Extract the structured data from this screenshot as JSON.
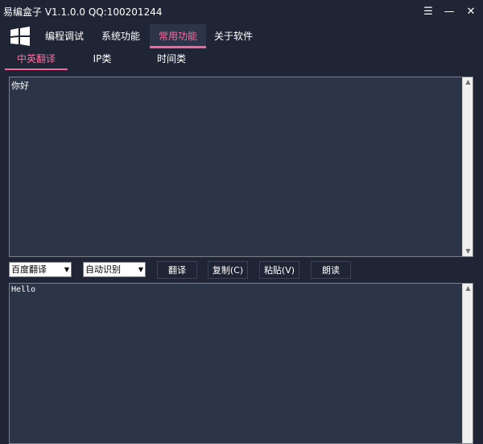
{
  "window": {
    "title": "易编盒子 V1.1.0.0 QQ:100201244",
    "buttons": {
      "settings": "☰",
      "minimize": "—",
      "close": "✕"
    }
  },
  "menu": {
    "items": [
      "编程调试",
      "系统功能",
      "常用功能",
      "关于软件"
    ],
    "active_index": 2
  },
  "subtabs": {
    "items": [
      "中英翻译",
      "IP类",
      "时间类"
    ],
    "active_index": 0
  },
  "input_area": {
    "text": "你好"
  },
  "controls": {
    "engine_select": "百度翻译",
    "language_select": "自动识别",
    "buttons": [
      "翻译",
      "复制(C)",
      "粘贴(V)",
      "朗读"
    ]
  },
  "output_area": {
    "text": "Hello"
  },
  "colors": {
    "accent": "#f5659b",
    "background": "#1f2534",
    "panel": "#2c3447"
  }
}
